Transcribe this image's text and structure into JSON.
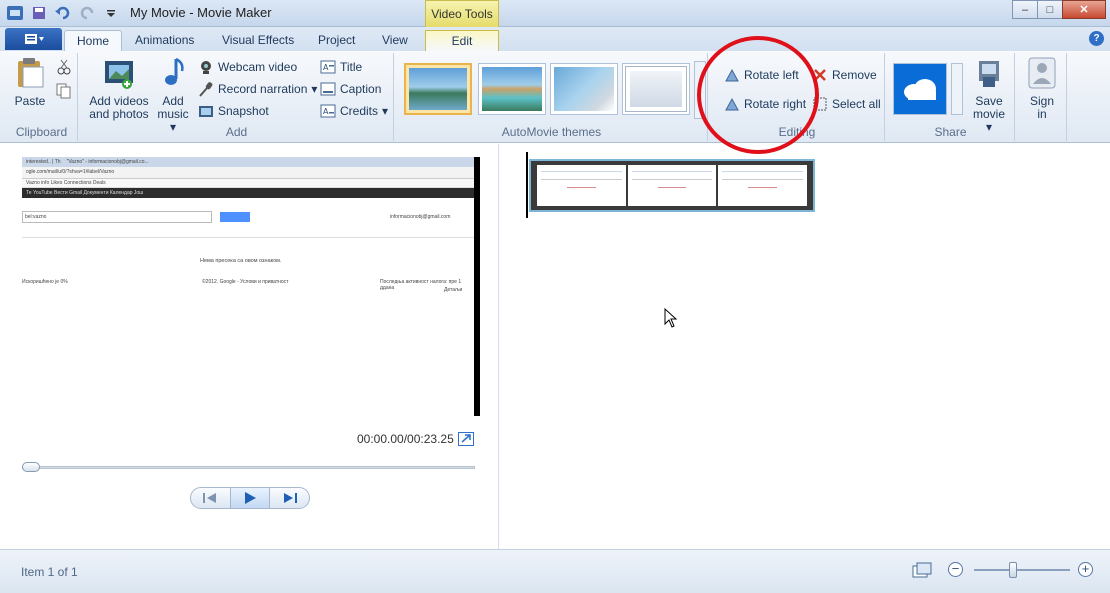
{
  "window": {
    "title": "My Movie - Movie Maker",
    "contextual_group": "Video Tools",
    "controls": {
      "minimize": "–",
      "maximize": "□",
      "close": "✕"
    }
  },
  "tabs": {
    "file_icon": "☰",
    "items": [
      "Home",
      "Animations",
      "Visual Effects",
      "Project",
      "View"
    ],
    "contextual_tab": "Edit",
    "help": "?"
  },
  "ribbon": {
    "clipboard": {
      "paste": "Paste",
      "label": "Clipboard"
    },
    "add": {
      "add_videos_line1": "Add videos",
      "add_videos_line2": "and photos",
      "add_music_line1": "Add",
      "add_music_line2": "music",
      "webcam": "Webcam video",
      "narration": "Record narration",
      "snapshot": "Snapshot",
      "title": "Title",
      "caption": "Caption",
      "credits": "Credits",
      "label": "Add"
    },
    "themes": {
      "label": "AutoMovie themes"
    },
    "editing": {
      "rotate_left": "Rotate left",
      "rotate_right": "Rotate right",
      "remove": "Remove",
      "select_all": "Select all",
      "label": "Editing"
    },
    "share": {
      "save_line1": "Save",
      "save_line2": "movie",
      "label": "Share"
    },
    "signin": {
      "line1": "Sign",
      "line2": "in"
    }
  },
  "preview": {
    "timecode": "00:00.00/00:23.25",
    "browser": {
      "tab1": "interested.. | Th",
      "tab2": "\"Vazno\" - informacionobj@gmail.co...",
      "address": "ogle.com/mail/u/0/?shva=1#label/Vazno",
      "bookmarks": "Vazno  info  Likes  Connections  Deals",
      "gbar": "Те  YouTube  Вести  Gmail  Документи  Календар  Још",
      "search_text": "bel:vazno",
      "account": "informacionobj@gmail.com",
      "empty_msg": "Нема пресека са овом ознаком.",
      "footer_left": "Искоришћено је 0%",
      "footer_mid": "©2012. Google - Услови и приватност",
      "footer_right": "Последња активност налога: пре 1 ддана",
      "footer_right2": "Детаљи"
    }
  },
  "status": {
    "text": "Item 1 of 1",
    "zoom_out": "−",
    "zoom_in": "+",
    "zoom_level": 0.5
  },
  "colors": {
    "annotation": "#e0101a",
    "ribbon_accent": "#2f6fc7",
    "onedrive": "#0a6cd6"
  }
}
